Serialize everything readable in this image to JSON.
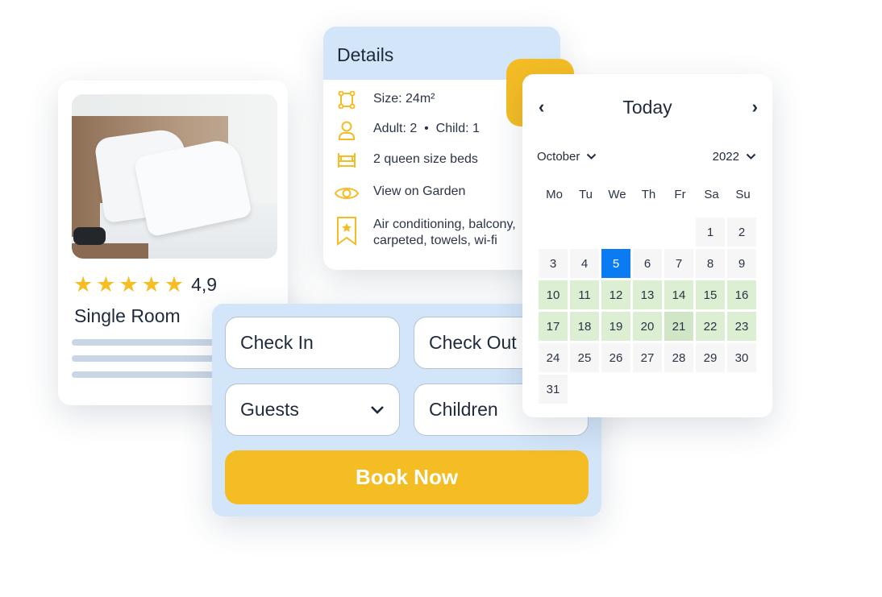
{
  "colors": {
    "accent_yellow": "#f4bd24",
    "panel_blue": "#d3e5f8",
    "today_blue": "#0a7bf2",
    "range_green": "#dcefd3",
    "text": "#1f2a3c"
  },
  "room": {
    "title": "Single Room",
    "rating": "4,9",
    "stars": 5,
    "image": "hotel-bed-photo"
  },
  "details": {
    "title": "Details",
    "items": [
      {
        "icon": "size-area-icon",
        "text": "Size: 24m²"
      },
      {
        "icon": "person-icon",
        "text": "Adult: 2  •  Child: 1"
      },
      {
        "icon": "bed-icon",
        "text": "2 queen size beds"
      },
      {
        "icon": "eye-icon",
        "text": "View on Garden"
      },
      {
        "icon": "bookmark-star-icon",
        "text": "Air conditioning, balcony, carpeted, towels, wi-fi"
      }
    ]
  },
  "calendar": {
    "title": "Today",
    "month": "October",
    "year": "2022",
    "weekdays": [
      "Mo",
      "Tu",
      "We",
      "Th",
      "Fr",
      "Sa",
      "Su"
    ],
    "leading_blanks": 5,
    "days": 31,
    "today": 5,
    "range": [
      10,
      23
    ],
    "hovered": 21
  },
  "booking": {
    "check_in": "Check In",
    "check_out": "Check Out",
    "guests": "Guests",
    "children": "Children",
    "book_now": "Book Now"
  }
}
